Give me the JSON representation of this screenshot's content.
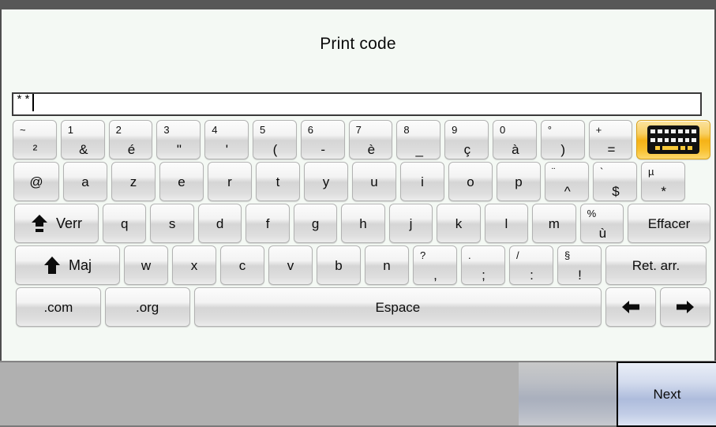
{
  "window": {
    "title": "Print code",
    "background_color": "#f4f9f4",
    "topbar_color": "#575757"
  },
  "input": {
    "name": "code-input",
    "value": "**",
    "placeholder": ""
  },
  "keyboard": {
    "layout": "AZERTY (French)",
    "rows": [
      {
        "id": "row-numbers",
        "keys": [
          {
            "name": "key-tilde-superscript2",
            "alt": "~",
            "main": "²",
            "type": "dual",
            "width": "w-std"
          },
          {
            "name": "key-1-ampersand",
            "alt": "1",
            "main": "&",
            "type": "dual",
            "width": "w-std"
          },
          {
            "name": "key-2-eacute",
            "alt": "2",
            "main": "é",
            "type": "dual",
            "width": "w-std"
          },
          {
            "name": "key-3-quote",
            "alt": "3",
            "main": "\"",
            "type": "dual",
            "width": "w-std"
          },
          {
            "name": "key-4-apostrophe",
            "alt": "4",
            "main": "'",
            "type": "dual",
            "width": "w-std"
          },
          {
            "name": "key-5-parenleft",
            "alt": "5",
            "main": "(",
            "type": "dual",
            "width": "w-std"
          },
          {
            "name": "key-6-hyphen",
            "alt": "6",
            "main": "-",
            "type": "dual",
            "width": "w-std"
          },
          {
            "name": "key-7-egrave",
            "alt": "7",
            "main": "è",
            "type": "dual",
            "width": "w-std"
          },
          {
            "name": "key-8-underscore",
            "alt": "8",
            "main": "_",
            "type": "dual",
            "width": "w-std"
          },
          {
            "name": "key-9-ccedilla",
            "alt": "9",
            "main": "ç",
            "type": "dual",
            "width": "w-std"
          },
          {
            "name": "key-0-agrave",
            "alt": "0",
            "main": "à",
            "type": "dual",
            "width": "w-std"
          },
          {
            "name": "key-degree-parenright",
            "alt": "°",
            "main": ")",
            "type": "dual",
            "width": "w-std"
          },
          {
            "name": "key-plus-equals",
            "alt": "+",
            "main": "=",
            "type": "dual",
            "width": "w-std"
          },
          {
            "name": "key-keyboard-switch",
            "alt": "",
            "main": "",
            "type": "keyboard-icon",
            "width": "w-kbico"
          }
        ]
      },
      {
        "id": "row-azerty",
        "keys": [
          {
            "name": "key-at",
            "alt": "",
            "main": "@",
            "type": "single",
            "width": "w-at"
          },
          {
            "name": "key-a",
            "alt": "",
            "main": "a",
            "type": "single",
            "width": "w-std"
          },
          {
            "name": "key-z",
            "alt": "",
            "main": "z",
            "type": "single",
            "width": "w-std"
          },
          {
            "name": "key-e",
            "alt": "",
            "main": "e",
            "type": "single",
            "width": "w-std"
          },
          {
            "name": "key-r",
            "alt": "",
            "main": "r",
            "type": "single",
            "width": "w-std"
          },
          {
            "name": "key-t",
            "alt": "",
            "main": "t",
            "type": "single",
            "width": "w-std"
          },
          {
            "name": "key-y",
            "alt": "",
            "main": "y",
            "type": "single",
            "width": "w-std"
          },
          {
            "name": "key-u",
            "alt": "",
            "main": "u",
            "type": "single",
            "width": "w-std"
          },
          {
            "name": "key-i",
            "alt": "",
            "main": "i",
            "type": "single",
            "width": "w-std"
          },
          {
            "name": "key-o",
            "alt": "",
            "main": "o",
            "type": "single",
            "width": "w-std"
          },
          {
            "name": "key-p",
            "alt": "",
            "main": "p",
            "type": "single",
            "width": "w-std"
          },
          {
            "name": "key-diaeresis-circumflex",
            "alt": "¨",
            "main": "^",
            "type": "dual",
            "width": "w-std"
          },
          {
            "name": "key-grave-dollar",
            "alt": "`",
            "main": "$",
            "type": "dual",
            "width": "w-std"
          },
          {
            "name": "key-mu-asterisk",
            "alt": "µ",
            "main": "*",
            "type": "dual",
            "width": "w-std"
          }
        ]
      },
      {
        "id": "row-qsdfgh",
        "keys": [
          {
            "name": "key-caps-lock",
            "alt": "",
            "main": "Verr",
            "type": "modifier-caps",
            "width": "w-verr"
          },
          {
            "name": "key-q",
            "alt": "",
            "main": "q",
            "type": "single",
            "width": "w-std"
          },
          {
            "name": "key-s",
            "alt": "",
            "main": "s",
            "type": "single",
            "width": "w-std"
          },
          {
            "name": "key-d",
            "alt": "",
            "main": "d",
            "type": "single",
            "width": "w-std"
          },
          {
            "name": "key-f",
            "alt": "",
            "main": "f",
            "type": "single",
            "width": "w-std"
          },
          {
            "name": "key-g",
            "alt": "",
            "main": "g",
            "type": "single",
            "width": "w-std"
          },
          {
            "name": "key-h",
            "alt": "",
            "main": "h",
            "type": "single",
            "width": "w-std"
          },
          {
            "name": "key-j",
            "alt": "",
            "main": "j",
            "type": "single",
            "width": "w-std"
          },
          {
            "name": "key-k",
            "alt": "",
            "main": "k",
            "type": "single",
            "width": "w-std"
          },
          {
            "name": "key-l",
            "alt": "",
            "main": "l",
            "type": "single",
            "width": "w-std"
          },
          {
            "name": "key-m",
            "alt": "",
            "main": "m",
            "type": "single",
            "width": "w-std"
          },
          {
            "name": "key-percent-ugrave",
            "alt": "%",
            "main": "ù",
            "type": "dual",
            "width": "w-std"
          },
          {
            "name": "key-clear",
            "alt": "",
            "main": "Effacer",
            "type": "single",
            "width": "w-eff"
          }
        ]
      },
      {
        "id": "row-wxcvbn",
        "keys": [
          {
            "name": "key-shift",
            "alt": "",
            "main": "Maj",
            "type": "modifier-shift",
            "width": "w-maj"
          },
          {
            "name": "key-w",
            "alt": "",
            "main": "w",
            "type": "single",
            "width": "w-std"
          },
          {
            "name": "key-x",
            "alt": "",
            "main": "x",
            "type": "single",
            "width": "w-std"
          },
          {
            "name": "key-c",
            "alt": "",
            "main": "c",
            "type": "single",
            "width": "w-std"
          },
          {
            "name": "key-v",
            "alt": "",
            "main": "v",
            "type": "single",
            "width": "w-std"
          },
          {
            "name": "key-b",
            "alt": "",
            "main": "b",
            "type": "single",
            "width": "w-std"
          },
          {
            "name": "key-n",
            "alt": "",
            "main": "n",
            "type": "single",
            "width": "w-std"
          },
          {
            "name": "key-question-comma",
            "alt": "?",
            "main": ",",
            "type": "dual",
            "width": "w-std"
          },
          {
            "name": "key-period-semicolon",
            "alt": ".",
            "main": ";",
            "type": "dual",
            "width": "w-std"
          },
          {
            "name": "key-slash-colon",
            "alt": "/",
            "main": ":",
            "type": "dual",
            "width": "w-std"
          },
          {
            "name": "key-section-exclamation",
            "alt": "§",
            "main": "!",
            "type": "dual",
            "width": "w-std"
          },
          {
            "name": "key-backspace",
            "alt": "",
            "main": "Ret. arr.",
            "type": "single",
            "width": "w-ret"
          }
        ]
      },
      {
        "id": "row-bottom",
        "keys": [
          {
            "name": "key-dot-com",
            "alt": "",
            "main": ".com",
            "type": "single",
            "width": "w-dom"
          },
          {
            "name": "key-dot-org",
            "alt": "",
            "main": ".org",
            "type": "single",
            "width": "w-dom"
          },
          {
            "name": "key-space",
            "alt": "",
            "main": "Espace",
            "type": "single",
            "width": "w-space"
          },
          {
            "name": "key-arrow-left",
            "alt": "",
            "main": "",
            "type": "arrow-left",
            "width": "w-arrow"
          },
          {
            "name": "key-arrow-right",
            "alt": "",
            "main": "",
            "type": "arrow-right",
            "width": "w-arrow"
          }
        ]
      }
    ]
  },
  "footer": {
    "next_label": "Next",
    "next_focused": true
  }
}
